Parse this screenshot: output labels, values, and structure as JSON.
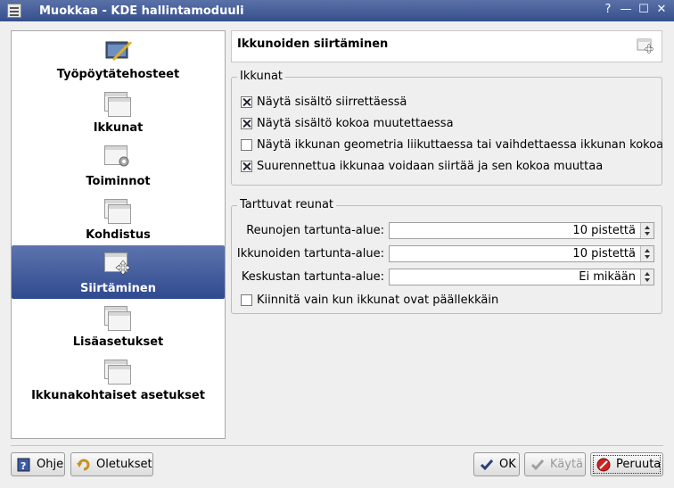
{
  "window": {
    "title": "Muokkaa - KDE hallintamoduuli",
    "controls": [
      "?",
      "—",
      "☐",
      "✕"
    ]
  },
  "sidebar": {
    "items": [
      {
        "label": "Työpöytätehosteet",
        "icon": "desktop-effects-icon",
        "active": false
      },
      {
        "label": "Ikkunat",
        "icon": "windows-icon",
        "active": false
      },
      {
        "label": "Toiminnot",
        "icon": "actions-icon",
        "active": false
      },
      {
        "label": "Kohdistus",
        "icon": "focus-icon",
        "active": false
      },
      {
        "label": "Siirtäminen",
        "icon": "moving-icon",
        "active": true
      },
      {
        "label": "Lisäasetukset",
        "icon": "advanced-icon",
        "active": false
      },
      {
        "label": "Ikkunakohtaiset asetukset",
        "icon": "window-specific-icon",
        "active": false
      }
    ]
  },
  "header": {
    "title": "Ikkunoiden siirtäminen",
    "icon": "move-window-icon"
  },
  "windows_group": {
    "legend": "Ikkunat",
    "options": [
      {
        "label": "Näytä sisältö siirrettäessä",
        "checked": true
      },
      {
        "label": "Näytä sisältö kokoa muutettaessa",
        "checked": true
      },
      {
        "label": "Näytä ikkunan geometria liikuttaessa tai vaihdettaessa ikkunan kokoa",
        "checked": false
      },
      {
        "label": "Suurennettua ikkunaa voidaan siirtää ja sen kokoa muuttaa",
        "checked": true
      }
    ]
  },
  "snap_group": {
    "legend": "Tarttuvat reunat",
    "fields": [
      {
        "label": "Reunojen tartunta-alue:",
        "value": "10 pistettä"
      },
      {
        "label": "Ikkunoiden tartunta-alue:",
        "value": "10 pistettä"
      },
      {
        "label": "Keskustan tartunta-alue:",
        "value": "Ei mikään"
      }
    ],
    "overlap_option": {
      "label": "Kiinnitä vain kun ikkunat ovat päällekkäin",
      "checked": false
    }
  },
  "buttons": {
    "help": "Ohje",
    "defaults": "Oletukset",
    "ok": "OK",
    "apply": "Käytä",
    "cancel": "Peruuta"
  },
  "colors": {
    "titlebar": "#364f8c",
    "selection": "#2f4a8f",
    "background": "#efefef"
  }
}
